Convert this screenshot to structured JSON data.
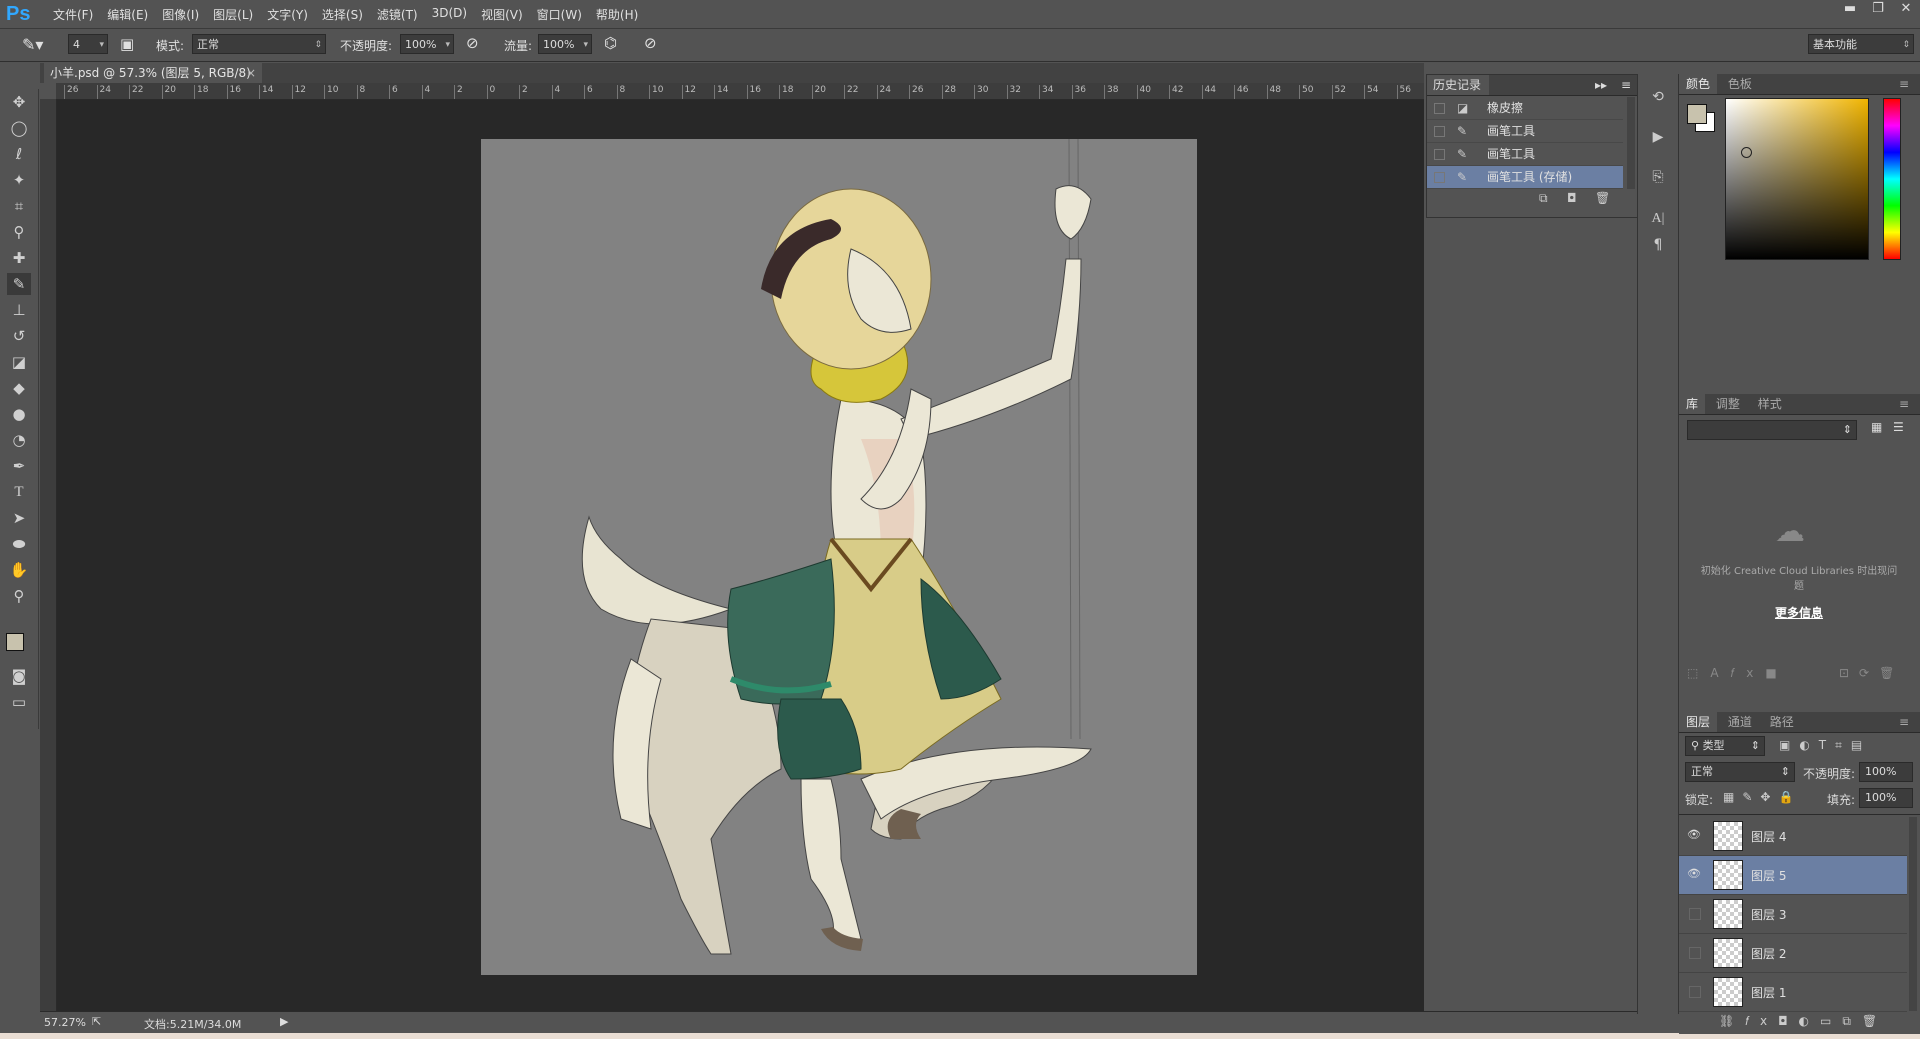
{
  "menubar": {
    "logo": "Ps",
    "items": [
      "文件(F)",
      "编辑(E)",
      "图像(I)",
      "图层(L)",
      "文字(Y)",
      "选择(S)",
      "滤镜(T)",
      "3D(D)",
      "视图(V)",
      "窗口(W)",
      "帮助(H)"
    ]
  },
  "options": {
    "brush_size": "4",
    "mode_label": "模式:",
    "mode_value": "正常",
    "opacity_label": "不透明度:",
    "opacity_value": "100%",
    "flow_label": "流量:",
    "flow_value": "100%",
    "workspace": "基本功能"
  },
  "document": {
    "tab_title": "小羊.psd @ 57.3% (图层 5, RGB/8)",
    "ruler_top": [
      "26",
      "24",
      "22",
      "20",
      "18",
      "16",
      "14",
      "12",
      "10",
      "8",
      "6",
      "4",
      "2",
      "0",
      "2",
      "4",
      "6",
      "8",
      "10",
      "12",
      "14",
      "16",
      "18",
      "20",
      "22",
      "24",
      "26",
      "28",
      "30",
      "32",
      "34",
      "36",
      "38",
      "40",
      "42",
      "44",
      "46",
      "48",
      "50",
      "52",
      "54",
      "56"
    ],
    "zoom": "57.27%",
    "doc_info": "文档:5.21M/34.0M"
  },
  "history": {
    "title": "历史记录",
    "rows": [
      {
        "label": "橡皮擦",
        "icon": "eraser-icon"
      },
      {
        "label": "画笔工具",
        "icon": "brush-icon"
      },
      {
        "label": "画笔工具",
        "icon": "brush-icon"
      },
      {
        "label": "画笔工具 (存储)",
        "icon": "brush-icon"
      }
    ]
  },
  "color_panel": {
    "tabs": [
      "颜色",
      "色板"
    ],
    "fg_color": "#c8c2ad",
    "bg_color": "#ffffff",
    "base_hue": "#f0b400"
  },
  "library_panel": {
    "tabs": [
      "库",
      "调整",
      "样式"
    ],
    "message": "初始化 Creative Cloud Libraries 时出现问题",
    "link": "更多信息"
  },
  "layers_panel": {
    "tabs": [
      "图层",
      "通道",
      "路径"
    ],
    "filter_label": "类型",
    "blend_mode": "正常",
    "opacity_label": "不透明度:",
    "opacity_value": "100%",
    "lock_label": "锁定:",
    "fill_label": "填充:",
    "fill_value": "100%",
    "layers": [
      {
        "name": "图层 4",
        "visible": true,
        "selected": false
      },
      {
        "name": "图层 5",
        "visible": true,
        "selected": true
      },
      {
        "name": "图层 3",
        "visible": false,
        "selected": false
      },
      {
        "name": "图层 2",
        "visible": false,
        "selected": false
      },
      {
        "name": "图层 1",
        "visible": false,
        "selected": false
      }
    ]
  }
}
